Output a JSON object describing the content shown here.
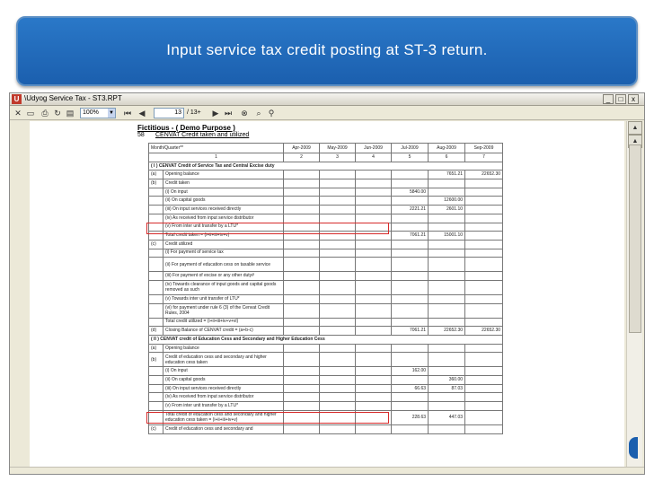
{
  "banner": {
    "title": "Input service tax credit posting at ST-3 return."
  },
  "window": {
    "title": "\\Udyog Service Tax - ST3.RPT",
    "controls": {
      "minimize": "_",
      "restore": "□",
      "close": "x"
    }
  },
  "toolbar": {
    "zoom": "100%",
    "page_current": "13",
    "page_total": "/ 13+"
  },
  "report": {
    "company": "Fictitious - ( Demo Purpose )",
    "section_no": "58",
    "section_title": "CENVAT Credit taken and utilized",
    "header": {
      "month_label": "Month/Quarter**",
      "months": [
        "Apr-2009",
        "May-2009",
        "Jun-2009",
        "Jul-2009",
        "Aug-2009",
        "Sep-2009"
      ],
      "col_nums": [
        "1",
        "2",
        "3",
        "4",
        "5",
        "6",
        "7"
      ]
    },
    "sections": {
      "s1": "( I ) CENVAT Credit of Service Tax and Central Excise duty",
      "s2": "( II ) CENVAT credit of Education Cess and Secondary and Higher Education Cess"
    },
    "rows": [
      {
        "code": "(a)",
        "label": "Opening balance",
        "v": [
          "",
          "",
          "",
          "",
          "7651.21",
          "22652.30"
        ]
      },
      {
        "code": "(b)",
        "label": "Credit taken",
        "v": [
          "",
          "",
          "",
          "",
          "",
          ""
        ]
      },
      {
        "code": "",
        "label": "(i) On input",
        "v": [
          "",
          "",
          "",
          "5840.00",
          "",
          ""
        ]
      },
      {
        "code": "",
        "label": "(ii) On capital goods",
        "v": [
          "",
          "",
          "",
          "",
          "12600.00",
          ""
        ]
      },
      {
        "code": "",
        "label": "(iii) On input services received directly",
        "v": [
          "",
          "",
          "",
          "2221.21",
          "2601.10",
          ""
        ]
      },
      {
        "code": "",
        "label": "(iv) As received from input service distributor",
        "v": [
          "",
          "",
          "",
          "",
          "",
          ""
        ]
      },
      {
        "code": "",
        "label": "(v) From inter unit transfer by a LTU*",
        "v": [
          "",
          "",
          "",
          "",
          "",
          ""
        ]
      },
      {
        "code": "",
        "label": "Total credit taken = (i+ii+iii+iv+v)",
        "v": [
          "",
          "",
          "",
          "7061.21",
          "15001.10",
          ""
        ]
      },
      {
        "code": "(c)",
        "label": "Credit utilized",
        "v": [
          "",
          "",
          "",
          "",
          "",
          ""
        ]
      },
      {
        "code": "",
        "label": "(i) For payment of service tax",
        "v": [
          "",
          "",
          "",
          "",
          "",
          ""
        ]
      },
      {
        "code": "",
        "label": "(ii) For payment of education cess on taxable service",
        "v": [
          "",
          "",
          "",
          "",
          "",
          ""
        ]
      },
      {
        "code": "",
        "label": "(iii) For payment of excise or any other duty#",
        "v": [
          "",
          "",
          "",
          "",
          "",
          ""
        ]
      },
      {
        "code": "",
        "label": "(iv) Towards clearance of input goods and capital goods removed as such",
        "v": [
          "",
          "",
          "",
          "",
          "",
          ""
        ]
      },
      {
        "code": "",
        "label": "(v) Towards inter unit transfer of LTU*",
        "v": [
          "",
          "",
          "",
          "",
          "",
          ""
        ]
      },
      {
        "code": "",
        "label": "(vi) for payment under rule 6 (3) of the Cenvat Credit Rules, 2004",
        "v": [
          "",
          "",
          "",
          "",
          "",
          ""
        ]
      },
      {
        "code": "",
        "label": "Total credit utilized = (i+ii+iii+iv+v+vi)",
        "v": [
          "",
          "",
          "",
          "",
          "",
          ""
        ]
      },
      {
        "code": "(d)",
        "label": "Closing Balance of CENVAT credit = (a+b-c)",
        "v": [
          "",
          "",
          "",
          "7061.21",
          "22652.30",
          "22652.30"
        ]
      },
      {
        "code": "(a)",
        "label": "Opening balance",
        "v": [
          "",
          "",
          "",
          "",
          "",
          ""
        ]
      },
      {
        "code": "(b)",
        "label": "Credit of education cess and secondary and higher education cess taken",
        "v": [
          "",
          "",
          "",
          "",
          "",
          ""
        ]
      },
      {
        "code": "",
        "label": "(i) On input",
        "v": [
          "",
          "",
          "",
          "162.00",
          "",
          ""
        ]
      },
      {
        "code": "",
        "label": "(ii) On capital goods",
        "v": [
          "",
          "",
          "",
          "",
          "360.00",
          ""
        ]
      },
      {
        "code": "",
        "label": "(iii) On input services received directly",
        "v": [
          "",
          "",
          "",
          "66.63",
          "87.03",
          ""
        ]
      },
      {
        "code": "",
        "label": "(iv) As received from input service distributor",
        "v": [
          "",
          "",
          "",
          "",
          "",
          ""
        ]
      },
      {
        "code": "",
        "label": "(v) From inter unit transfer by a LTU*",
        "v": [
          "",
          "",
          "",
          "",
          "",
          ""
        ]
      },
      {
        "code": "",
        "label": "Total credit of education cess and secondary and higher education cess taken = (i+ii+iii+iv+v)",
        "v": [
          "",
          "",
          "",
          "228.63",
          "447.03",
          ""
        ]
      },
      {
        "code": "(c)",
        "label": "Credit of education cess and secondary and",
        "v": [
          "",
          "",
          "",
          "",
          "",
          ""
        ]
      }
    ]
  }
}
